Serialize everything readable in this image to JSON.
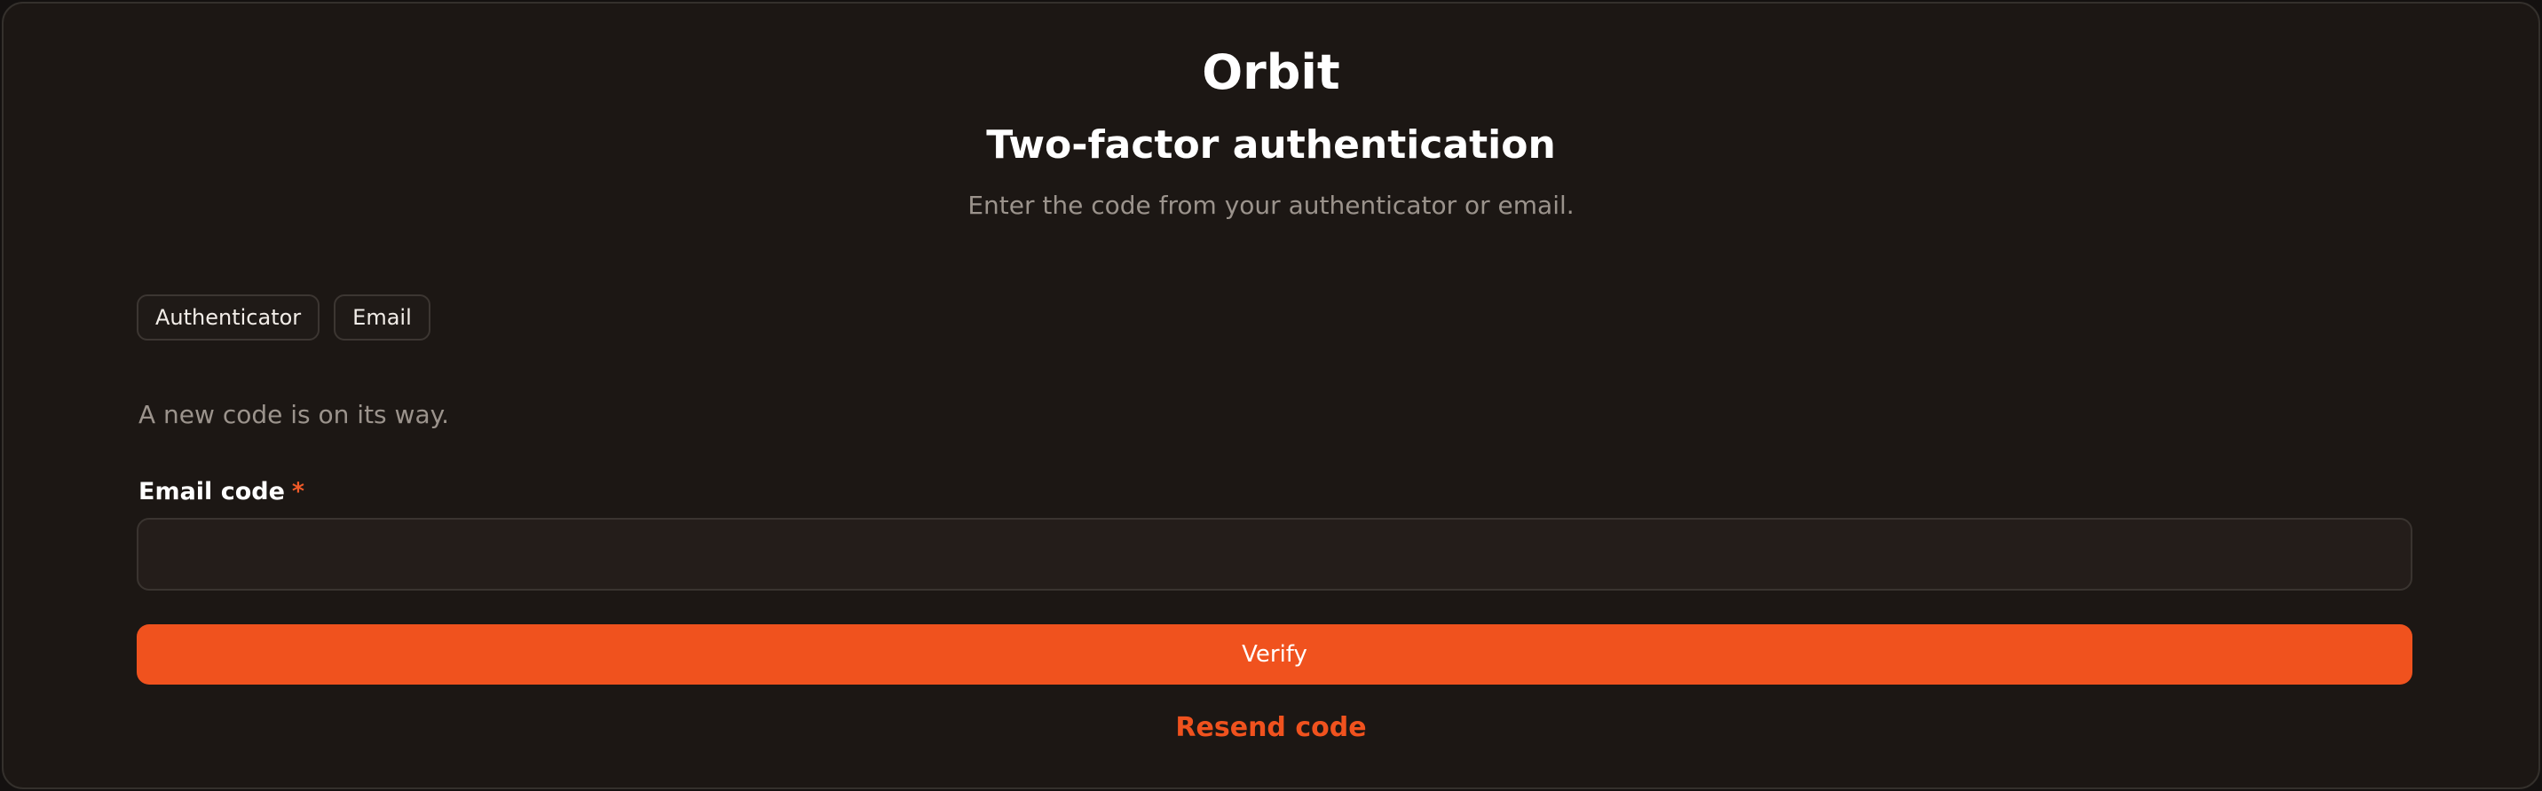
{
  "brand": "Orbit",
  "header": {
    "title": "Two-factor authentication",
    "subtitle": "Enter the code from your authenticator or email."
  },
  "tabs": [
    {
      "label": "Authenticator"
    },
    {
      "label": "Email"
    }
  ],
  "notice": "A new code is on its way.",
  "form": {
    "label": "Email code",
    "required_mark": "*",
    "value": "",
    "placeholder": ""
  },
  "actions": {
    "verify_label": "Verify",
    "resend_label": "Resend code"
  },
  "colors": {
    "accent": "#f0521e",
    "background": "#1c1714"
  }
}
